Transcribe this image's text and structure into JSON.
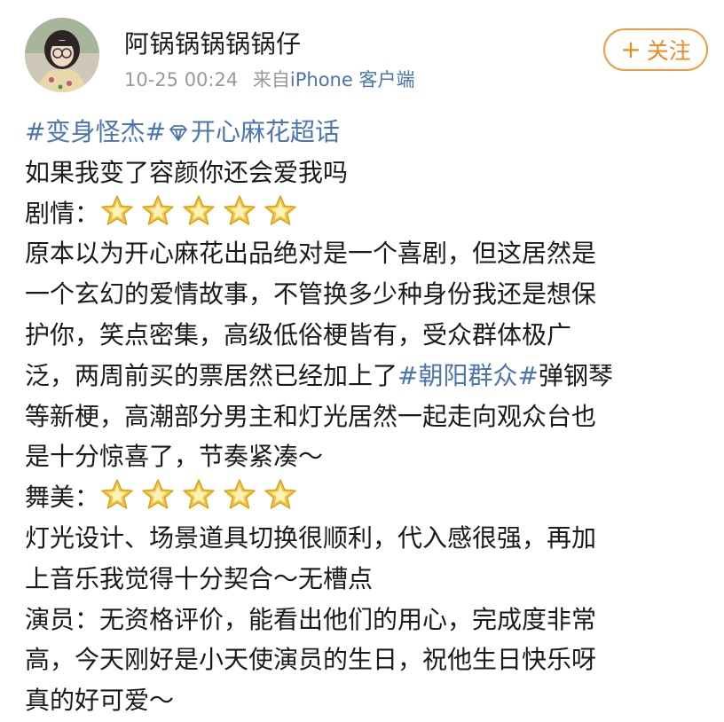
{
  "post": {
    "username": "阿锅锅锅锅锅仔",
    "timestamp": "10-25 00:24",
    "source_prefix": "来自",
    "source_device": "iPhone 客户端",
    "follow_label": "关注",
    "follow_plus": "+"
  },
  "topics": {
    "tag1": "#变身怪杰#",
    "tag2_prefix_icon": "diamond-icon",
    "tag2": "开心麻花超话"
  },
  "body": {
    "line1": "如果我变了容颜你还会爱我吗",
    "plot_label": "剧情：",
    "plot_rating": 5,
    "plot_p1": "原本以为开心麻花出品绝对是一个喜剧，但这居然是",
    "plot_p2": "一个玄幻的爱情故事，不管换多少种身份我还是想保",
    "plot_p3": "护你，笑点密集，高级低俗梗皆有，受众群体极广",
    "plot_p4_a": "泛，两周前买的票居然已经加上了",
    "plot_p4_tag": "#朝阳群众#",
    "plot_p4_b": "弹钢琴",
    "plot_p5": "等新梗，高潮部分男主和灯光居然一起走向观众台也",
    "plot_p6": "是十分惊喜了，节奏紧凑～",
    "stage_label": "舞美：",
    "stage_rating": 5,
    "stage_p1": "灯光设计、场景道具切换很顺利，代入感很强，再加",
    "stage_p2": "上音乐我觉得十分契合～无槽点",
    "actor_p1": "演员：无资格评价，能看出他们的用心，完成度非常",
    "actor_p2": "高，今天刚好是小天使演员的生日，祝他生日快乐呀",
    "actor_p3": "真的好可爱～"
  },
  "colors": {
    "link": "#4a74b3",
    "follow_orange": "#f08a1e",
    "meta_gray": "#9a9a9a",
    "star": "#f5c542"
  },
  "icons": {
    "rating_star": "star-icon"
  }
}
